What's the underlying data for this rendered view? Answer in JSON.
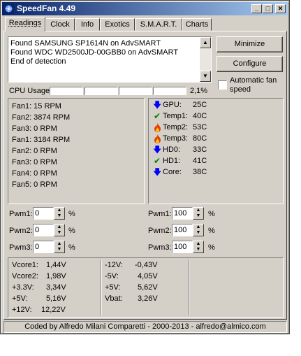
{
  "window": {
    "title": "SpeedFan 4.49"
  },
  "tabs": [
    "Readings",
    "Clock",
    "Info",
    "Exotics",
    "S.M.A.R.T.",
    "Charts"
  ],
  "log": [
    "Found SAMSUNG SP1614N on AdvSMART",
    "Found WDC WD2500JD-00GBB0 on AdvSMART",
    "End of detection"
  ],
  "buttons": {
    "minimize": "Minimize",
    "configure": "Configure"
  },
  "automatic_fan_speed": {
    "label_line1": "Automatic fan",
    "label_line2": "speed",
    "checked": false
  },
  "cpu_usage": {
    "label": "CPU Usage",
    "value": "2,1%"
  },
  "fans": [
    {
      "label": "Fan1: 15 RPM"
    },
    {
      "label": "Fan2: 3874 RPM"
    },
    {
      "label": "Fan3: 0 RPM"
    },
    {
      "label": "Fan1: 3184 RPM"
    },
    {
      "label": "Fan2: 0 RPM"
    },
    {
      "label": "Fan3: 0 RPM"
    },
    {
      "label": "Fan4: 0 RPM"
    },
    {
      "label": "Fan5: 0 RPM"
    }
  ],
  "temps": [
    {
      "name": "GPU:",
      "value": "25C",
      "icon": "arrow-down-icon"
    },
    {
      "name": "Temp1:",
      "value": "40C",
      "icon": "checkmark-icon"
    },
    {
      "name": "Temp2:",
      "value": "53C",
      "icon": "flame-icon"
    },
    {
      "name": "Temp3:",
      "value": "80C",
      "icon": "flame-icon"
    },
    {
      "name": "HD0:",
      "value": "33C",
      "icon": "arrow-down-icon"
    },
    {
      "name": "HD1:",
      "value": "41C",
      "icon": "checkmark-icon"
    },
    {
      "name": "Core:",
      "value": "38C",
      "icon": "arrow-down-icon"
    }
  ],
  "pwm_left": [
    {
      "label": "Pwm1:",
      "value": "0",
      "unit": "%"
    },
    {
      "label": "Pwm2:",
      "value": "0",
      "unit": "%"
    },
    {
      "label": "Pwm3:",
      "value": "0",
      "unit": "%"
    }
  ],
  "pwm_right": [
    {
      "label": "Pwm1:",
      "value": "100",
      "unit": "%"
    },
    {
      "label": "Pwm2:",
      "value": "100",
      "unit": "%"
    },
    {
      "label": "Pwm3:",
      "value": "100",
      "unit": "%"
    }
  ],
  "voltages_col1": [
    {
      "name": "Vcore1:",
      "value": "1,44V"
    },
    {
      "name": "Vcore2:",
      "value": "1,98V"
    },
    {
      "name": "+3.3V:",
      "value": "3,34V"
    },
    {
      "name": "+5V:",
      "value": "5,16V"
    },
    {
      "name": "+12V:",
      "value": "12,22V"
    }
  ],
  "voltages_col2": [
    {
      "name": "-12V:",
      "value": "-0,43V"
    },
    {
      "name": "-5V:",
      "value": "4,05V"
    },
    {
      "name": "+5V:",
      "value": "5,62V"
    },
    {
      "name": "Vbat:",
      "value": "3,26V"
    }
  ],
  "status": "Coded by Alfredo Milani Comparetti - 2000-2013 - alfredo@almico.com",
  "colors": {
    "title_active": "#0a246a",
    "face": "#d4d0c8",
    "arrow_blue": "#0000ff",
    "check_green": "#008000",
    "flame_red": "#e04000"
  }
}
